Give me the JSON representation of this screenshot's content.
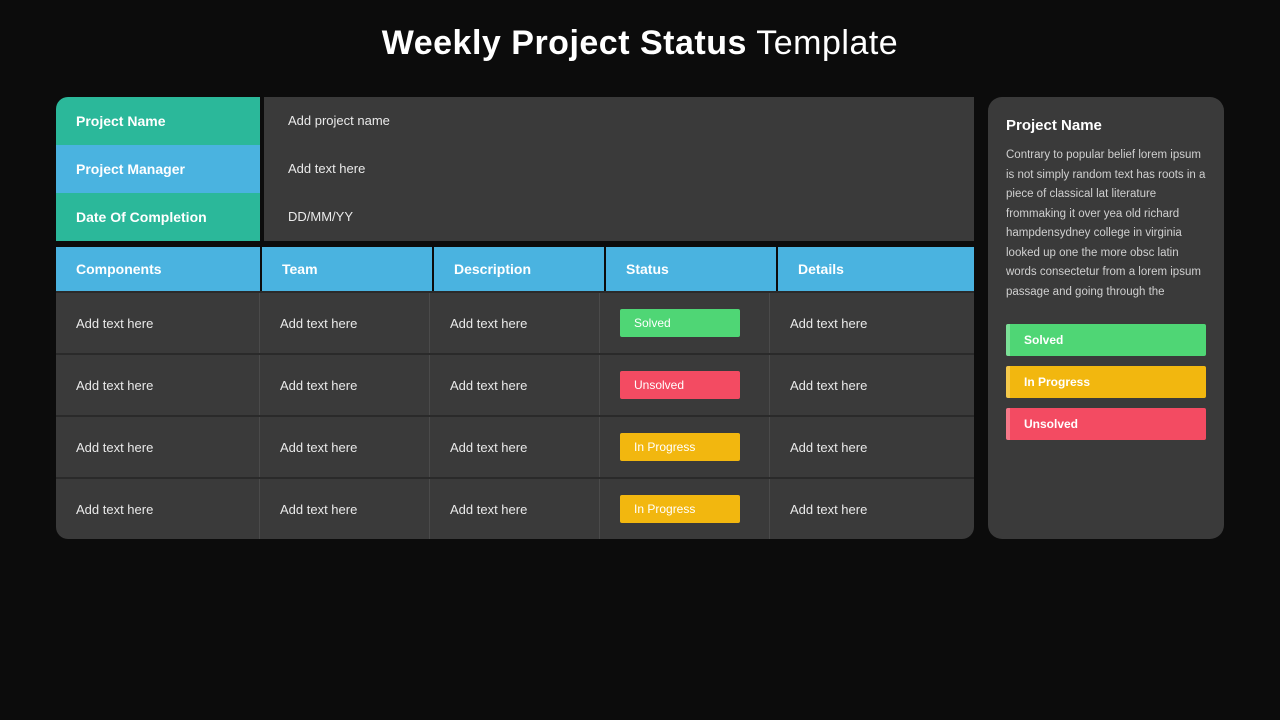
{
  "title": {
    "bold": "Weekly Project Status",
    "light": "Template"
  },
  "meta": [
    {
      "label": "Project Name",
      "value": "Add project name",
      "color": "teal"
    },
    {
      "label": "Project Manager",
      "value": "Add text here",
      "color": "blue"
    },
    {
      "label": "Date Of Completion",
      "value": "DD/MM/YY",
      "color": "teal"
    }
  ],
  "columns": [
    "Components",
    "Team",
    "Description",
    "Status",
    "Details"
  ],
  "rows": [
    {
      "cells": [
        "Add text here",
        "Add text here",
        "Add text here",
        "",
        "Add text here"
      ],
      "status": {
        "label": "Solved",
        "color": "green"
      }
    },
    {
      "cells": [
        "Add text here",
        "Add text here",
        "Add text here",
        "",
        "Add text here"
      ],
      "status": {
        "label": "Unsolved",
        "color": "red"
      }
    },
    {
      "cells": [
        "Add text here",
        "Add text here",
        "Add text here",
        "",
        "Add text here"
      ],
      "status": {
        "label": "In Progress",
        "color": "yellow"
      }
    },
    {
      "cells": [
        "Add text here",
        "Add text here",
        "Add text here",
        "",
        "Add text here"
      ],
      "status": {
        "label": "In Progress",
        "color": "yellow"
      }
    }
  ],
  "side": {
    "title": "Project Name",
    "body": "Contrary to popular belief lorem ipsum is not simply random text has roots in a piece of classical lat literature frommaking it over yea old richard hampdensydney college in virginia looked up one the more obsc latin words consectetur from a lorem ipsum passage and going through the",
    "legend": [
      {
        "label": "Solved",
        "color": "green"
      },
      {
        "label": "In Progress",
        "color": "yellow"
      },
      {
        "label": "Unsolved",
        "color": "red"
      }
    ]
  }
}
